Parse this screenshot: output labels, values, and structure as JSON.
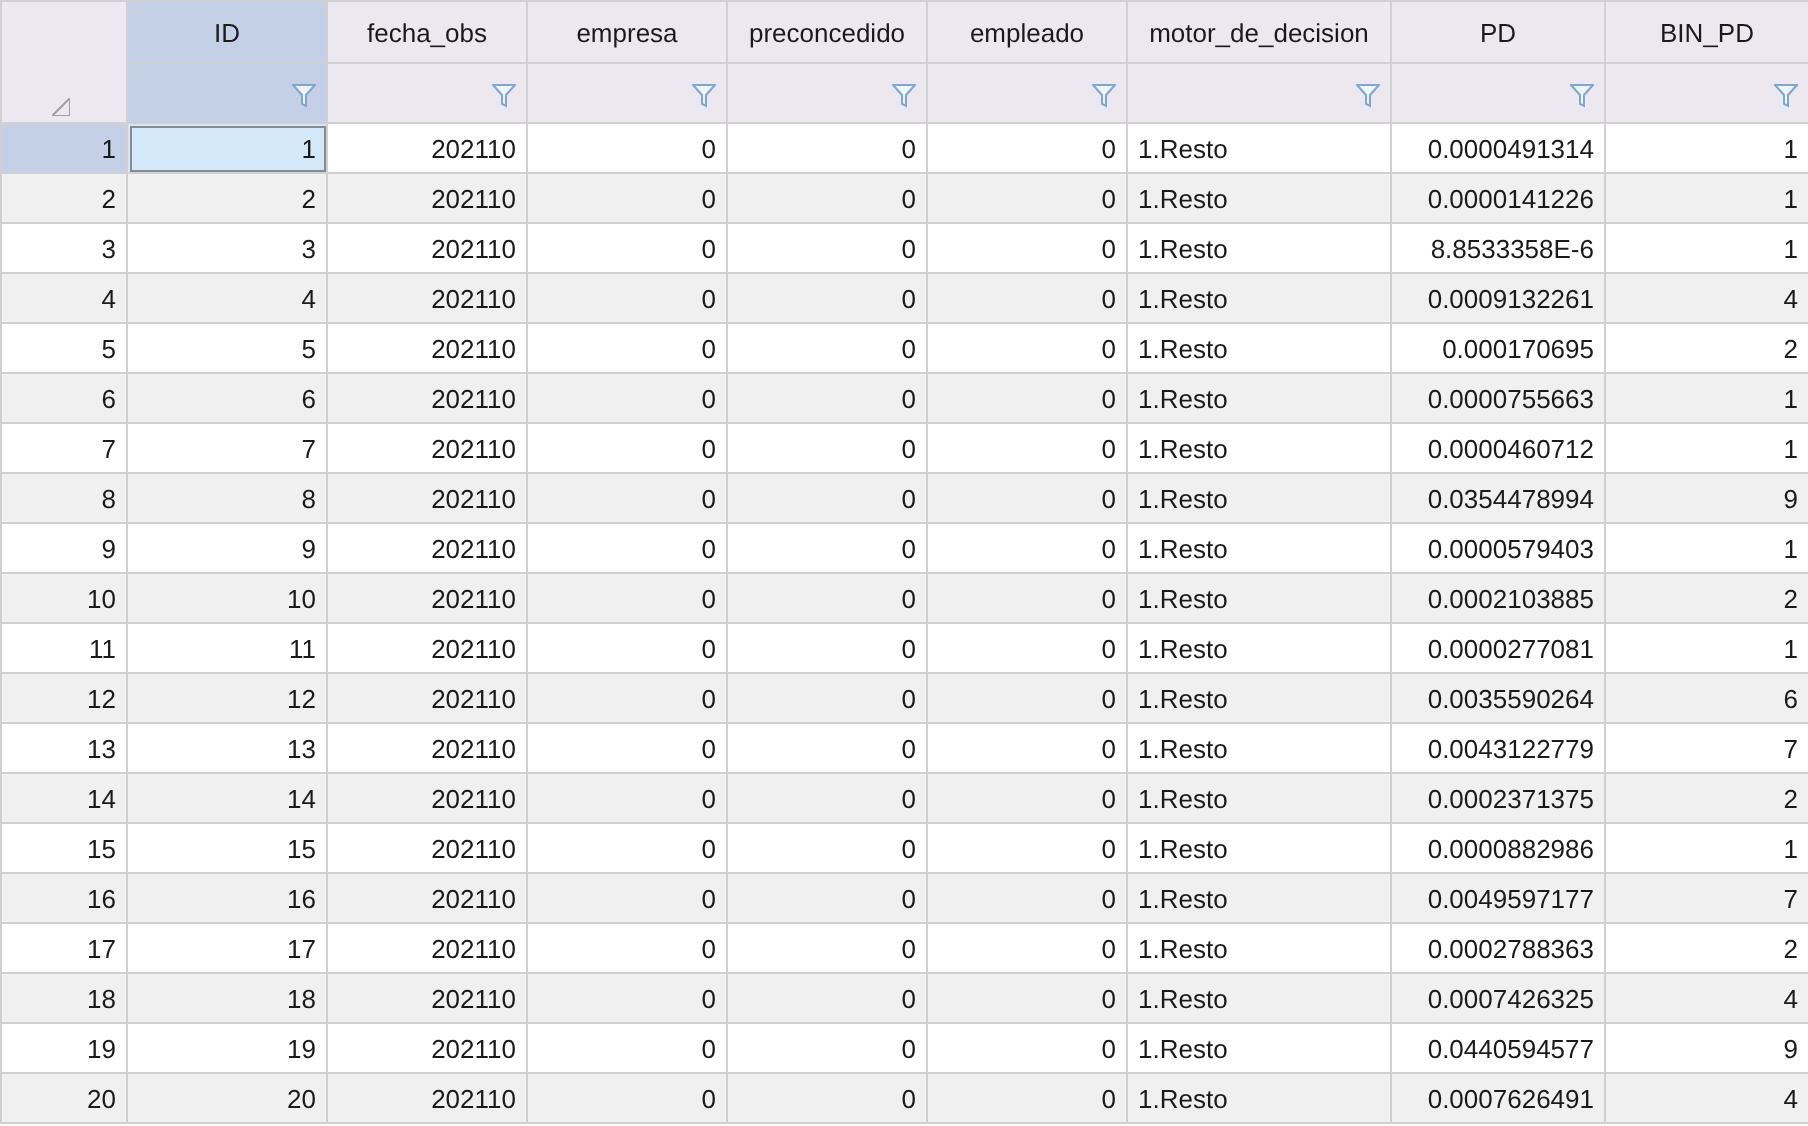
{
  "table": {
    "columns": [
      {
        "label": "ID",
        "kind": "number",
        "selected": true
      },
      {
        "label": "fecha_obs",
        "kind": "number",
        "selected": false
      },
      {
        "label": "empresa",
        "kind": "number",
        "selected": false
      },
      {
        "label": "preconcedido",
        "kind": "number",
        "selected": false
      },
      {
        "label": "empleado",
        "kind": "number",
        "selected": false
      },
      {
        "label": "motor_de_decision",
        "kind": "text",
        "selected": false
      },
      {
        "label": "PD",
        "kind": "number",
        "selected": false
      },
      {
        "label": "BIN_PD",
        "kind": "number",
        "selected": false
      }
    ],
    "rows": [
      {
        "number": "1",
        "selected": true,
        "cells": [
          "1",
          "202110",
          "0",
          "0",
          "0",
          "1.Resto",
          "0.0000491314",
          "1"
        ]
      },
      {
        "number": "2",
        "selected": false,
        "cells": [
          "2",
          "202110",
          "0",
          "0",
          "0",
          "1.Resto",
          "0.0000141226",
          "1"
        ]
      },
      {
        "number": "3",
        "selected": false,
        "cells": [
          "3",
          "202110",
          "0",
          "0",
          "0",
          "1.Resto",
          "8.8533358E-6",
          "1"
        ]
      },
      {
        "number": "4",
        "selected": false,
        "cells": [
          "4",
          "202110",
          "0",
          "0",
          "0",
          "1.Resto",
          "0.0009132261",
          "4"
        ]
      },
      {
        "number": "5",
        "selected": false,
        "cells": [
          "5",
          "202110",
          "0",
          "0",
          "0",
          "1.Resto",
          "0.000170695",
          "2"
        ]
      },
      {
        "number": "6",
        "selected": false,
        "cells": [
          "6",
          "202110",
          "0",
          "0",
          "0",
          "1.Resto",
          "0.0000755663",
          "1"
        ]
      },
      {
        "number": "7",
        "selected": false,
        "cells": [
          "7",
          "202110",
          "0",
          "0",
          "0",
          "1.Resto",
          "0.0000460712",
          "1"
        ]
      },
      {
        "number": "8",
        "selected": false,
        "cells": [
          "8",
          "202110",
          "0",
          "0",
          "0",
          "1.Resto",
          "0.0354478994",
          "9"
        ]
      },
      {
        "number": "9",
        "selected": false,
        "cells": [
          "9",
          "202110",
          "0",
          "0",
          "0",
          "1.Resto",
          "0.0000579403",
          "1"
        ]
      },
      {
        "number": "10",
        "selected": false,
        "cells": [
          "10",
          "202110",
          "0",
          "0",
          "0",
          "1.Resto",
          "0.0002103885",
          "2"
        ]
      },
      {
        "number": "11",
        "selected": false,
        "cells": [
          "11",
          "202110",
          "0",
          "0",
          "0",
          "1.Resto",
          "0.0000277081",
          "1"
        ]
      },
      {
        "number": "12",
        "selected": false,
        "cells": [
          "12",
          "202110",
          "0",
          "0",
          "0",
          "1.Resto",
          "0.0035590264",
          "6"
        ]
      },
      {
        "number": "13",
        "selected": false,
        "cells": [
          "13",
          "202110",
          "0",
          "0",
          "0",
          "1.Resto",
          "0.0043122779",
          "7"
        ]
      },
      {
        "number": "14",
        "selected": false,
        "cells": [
          "14",
          "202110",
          "0",
          "0",
          "0",
          "1.Resto",
          "0.0002371375",
          "2"
        ]
      },
      {
        "number": "15",
        "selected": false,
        "cells": [
          "15",
          "202110",
          "0",
          "0",
          "0",
          "1.Resto",
          "0.0000882986",
          "1"
        ]
      },
      {
        "number": "16",
        "selected": false,
        "cells": [
          "16",
          "202110",
          "0",
          "0",
          "0",
          "1.Resto",
          "0.0049597177",
          "7"
        ]
      },
      {
        "number": "17",
        "selected": false,
        "cells": [
          "17",
          "202110",
          "0",
          "0",
          "0",
          "1.Resto",
          "0.0002788363",
          "2"
        ]
      },
      {
        "number": "18",
        "selected": false,
        "cells": [
          "18",
          "202110",
          "0",
          "0",
          "0",
          "1.Resto",
          "0.0007426325",
          "4"
        ]
      },
      {
        "number": "19",
        "selected": false,
        "cells": [
          "19",
          "202110",
          "0",
          "0",
          "0",
          "1.Resto",
          "0.0440594577",
          "9"
        ]
      },
      {
        "number": "20",
        "selected": false,
        "cells": [
          "20",
          "202110",
          "0",
          "0",
          "0",
          "1.Resto",
          "0.0007626491",
          "4"
        ]
      }
    ]
  }
}
